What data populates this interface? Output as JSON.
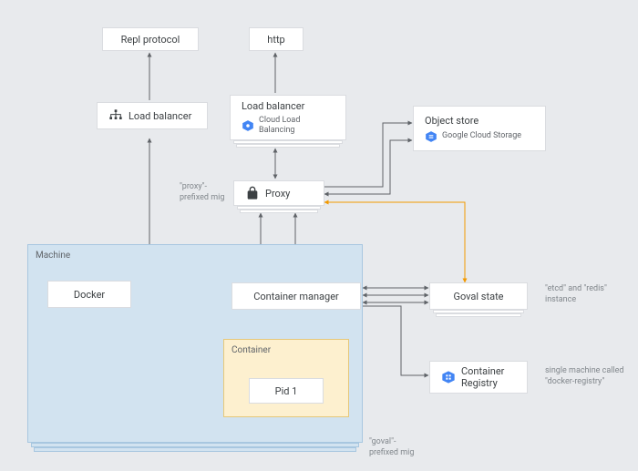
{
  "nodes": {
    "repl_protocol": "Repl protocol",
    "http": "http",
    "load_balancer_left": "Load balancer",
    "load_balancer_right": {
      "title": "Load balancer",
      "sub": "Cloud Load Balancing"
    },
    "proxy": "Proxy",
    "object_store": {
      "title": "Object store",
      "sub": "Google Cloud Storage"
    },
    "docker": "Docker",
    "container_manager": "Container manager",
    "goval_state": "Goval state",
    "pid1": "Pid 1",
    "container_registry": "Container Registry"
  },
  "groups": {
    "machine": "Machine",
    "container": "Container"
  },
  "annotations": {
    "proxy_mig": "\"proxy\"-prefixed mig",
    "goval_mig": "\"goval\"-prefixed mig",
    "etcd_redis": "\"etcd\" and \"redis\" instance",
    "docker_registry": "single machine called \"docker-registry\""
  },
  "colors": {
    "machine_bg": "#d2e3f0",
    "machine_border": "#a8c7e0",
    "container_bg": "#fdf0cf",
    "container_border": "#e6c87a",
    "arrow": "#5f6368",
    "arrow_orange": "#f29900",
    "gcp_blue": "#4285f4"
  }
}
